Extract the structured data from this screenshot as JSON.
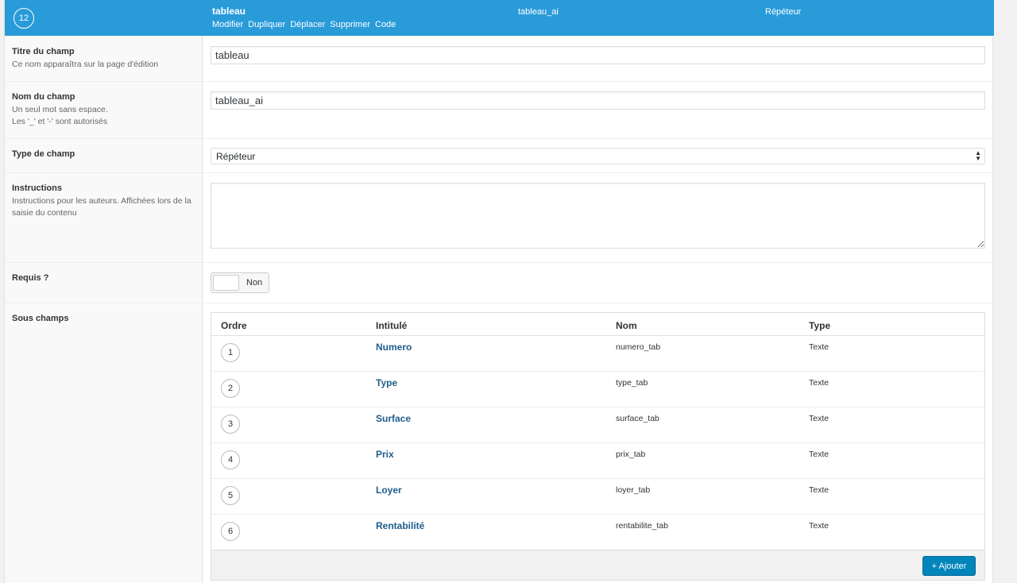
{
  "header": {
    "order": "12",
    "title": "tableau",
    "actions": [
      "Modifier",
      "Dupliquer",
      "Déplacer",
      "Supprimer",
      "Code"
    ],
    "name": "tableau_ai",
    "type": "Répéteur",
    "bg_color": "#2a9bd9"
  },
  "fields": {
    "title": {
      "label": "Titre du champ",
      "desc": "Ce nom apparaîtra sur la page d'édition",
      "value": "tableau"
    },
    "name": {
      "label": "Nom du champ",
      "desc1": "Un seul mot sans espace.",
      "desc2": "Les '_' et '-' sont autorisés",
      "value": "tableau_ai"
    },
    "type": {
      "label": "Type de champ",
      "value": "Répéteur"
    },
    "instructions": {
      "label": "Instructions",
      "desc": "Instructions pour les auteurs. Affichées lors de la saisie du contenu",
      "value": ""
    },
    "required": {
      "label": "Requis ?",
      "toggle_label": "Non",
      "checked": false
    },
    "subfields": {
      "label": "Sous champs"
    }
  },
  "subtable": {
    "columns": {
      "order": "Ordre",
      "label": "Intitulé",
      "name": "Nom",
      "type": "Type"
    },
    "rows": [
      {
        "order": "1",
        "label": "Numero",
        "name": "numero_tab",
        "type": "Texte"
      },
      {
        "order": "2",
        "label": "Type",
        "name": "type_tab",
        "type": "Texte"
      },
      {
        "order": "3",
        "label": "Surface",
        "name": "surface_tab",
        "type": "Texte"
      },
      {
        "order": "4",
        "label": "Prix",
        "name": "prix_tab",
        "type": "Texte"
      },
      {
        "order": "5",
        "label": "Loyer",
        "name": "loyer_tab",
        "type": "Texte"
      },
      {
        "order": "6",
        "label": "Rentabilité",
        "name": "rentabilite_tab",
        "type": "Texte"
      }
    ],
    "add_button": "+ Ajouter",
    "link_color": "#1f5d8c",
    "button_color": "#0085ba"
  }
}
